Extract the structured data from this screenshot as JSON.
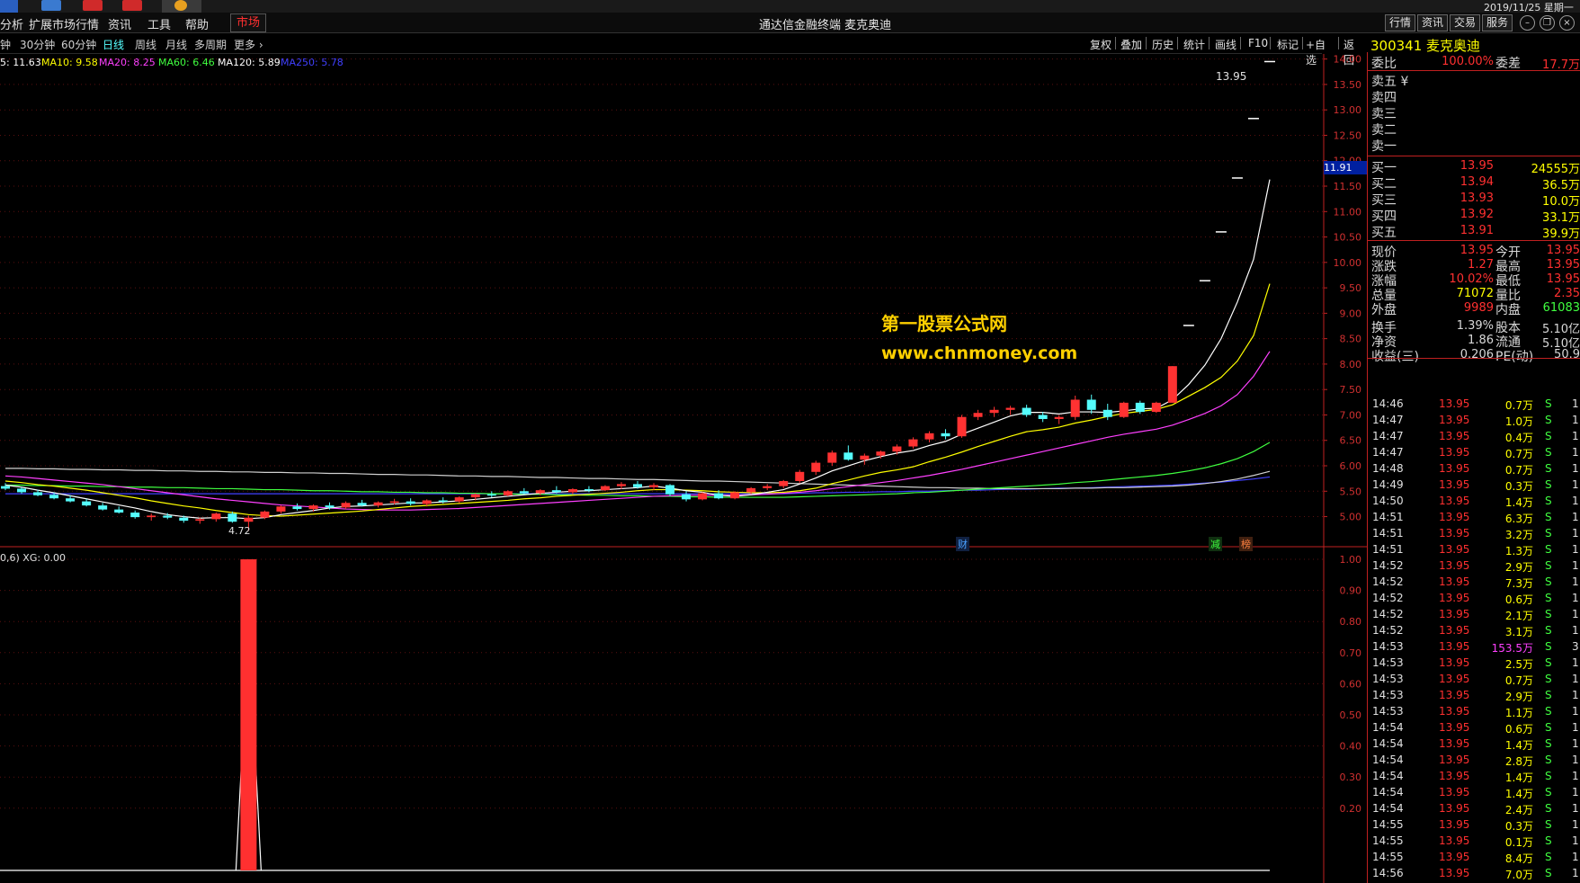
{
  "topbar": {
    "date_text": "2019/11/25 星期一"
  },
  "menu": {
    "items": [
      "分析",
      "扩展市场行情",
      "资讯",
      "工具",
      "帮助"
    ],
    "market_tab": "市场",
    "window_title": "通达信金融终端  麦克奥迪",
    "right_buttons": [
      "行情",
      "资讯",
      "交易",
      "服务"
    ]
  },
  "periods": {
    "items": [
      "钟",
      "30分钟",
      "60分钟",
      "日线",
      "周线",
      "月线",
      "多周期",
      "更多 ›"
    ],
    "active": "日线"
  },
  "tools": [
    "复权",
    "叠加",
    "历史",
    "统计",
    "画线",
    "F10",
    "标记",
    "+自选",
    "返回"
  ],
  "stock": {
    "code": "300341",
    "name": "麦克奥迪"
  },
  "ma_line": {
    "items": [
      {
        "text": "5: 11.63",
        "color": "#ffffff"
      },
      {
        "text": "MA10: 9.58",
        "color": "#ffff00"
      },
      {
        "text": "MA20: 8.25",
        "color": "#ff40ff"
      },
      {
        "text": "MA60: 6.46",
        "color": "#40ff40"
      },
      {
        "text": "MA120: 5.89",
        "color": "#ffffff"
      },
      {
        "text": "MA250: 5.78",
        "color": "#4040ff"
      }
    ]
  },
  "indicator_label": "0,6)  XG: 0.00",
  "chart_markers": {
    "high_label": "13.95",
    "low_label": "4.72",
    "cursor_price": "11.91",
    "event_tags": [
      {
        "text": "财",
        "color": "#4aa0ff"
      },
      {
        "text": "减",
        "color": "#40ff40"
      },
      {
        "text": "榜",
        "color": "#ff8040"
      }
    ]
  },
  "watermark": {
    "line1": "第一股票公式网",
    "line2": "www.chnmoney.com"
  },
  "colors": {
    "up": "#ff3232",
    "down": "#54fcfc",
    "axis": "#c02020",
    "text_red": "#ff3030",
    "text_yellow": "#ffff00",
    "text_green": "#40ff40"
  },
  "chart_data": {
    "type": "candlestick",
    "price_axis": {
      "ticks": [
        "14.00",
        "13.50",
        "13.00",
        "12.50",
        "12.00",
        "11.50",
        "11.00",
        "10.50",
        "10.00",
        "9.50",
        "9.00",
        "8.50",
        "8.00",
        "7.50",
        "7.00",
        "6.50",
        "6.00",
        "5.50",
        "5.00"
      ],
      "min": 4.55,
      "max": 14.1
    },
    "indicator_axis": {
      "ticks": [
        "1.00",
        "0.90",
        "0.80",
        "0.70",
        "0.60",
        "0.50",
        "0.40",
        "0.30",
        "0.20"
      ],
      "min": 0,
      "max": 1.0
    },
    "candles": [
      [
        5.6,
        5.66,
        5.52,
        5.55
      ],
      [
        5.55,
        5.58,
        5.45,
        5.48
      ],
      [
        5.48,
        5.53,
        5.4,
        5.42
      ],
      [
        5.43,
        5.48,
        5.34,
        5.36
      ],
      [
        5.36,
        5.42,
        5.28,
        5.3
      ],
      [
        5.3,
        5.35,
        5.2,
        5.22
      ],
      [
        5.22,
        5.27,
        5.12,
        5.14
      ],
      [
        5.14,
        5.2,
        5.06,
        5.08
      ],
      [
        5.08,
        5.12,
        4.96,
        4.99
      ],
      [
        4.99,
        5.06,
        4.92,
        5.02
      ],
      [
        5.02,
        5.07,
        4.95,
        4.98
      ],
      [
        4.98,
        5.02,
        4.88,
        4.92
      ],
      [
        4.92,
        4.98,
        4.86,
        4.95
      ],
      [
        4.95,
        5.08,
        4.9,
        5.06
      ],
      [
        5.06,
        5.1,
        4.88,
        4.9
      ],
      [
        4.9,
        5.02,
        4.72,
        4.98
      ],
      [
        4.98,
        5.12,
        4.95,
        5.1
      ],
      [
        5.1,
        5.22,
        5.06,
        5.2
      ],
      [
        5.2,
        5.26,
        5.12,
        5.15
      ],
      [
        5.15,
        5.24,
        5.1,
        5.22
      ],
      [
        5.22,
        5.28,
        5.14,
        5.18
      ],
      [
        5.18,
        5.3,
        5.15,
        5.27
      ],
      [
        5.27,
        5.33,
        5.2,
        5.22
      ],
      [
        5.22,
        5.3,
        5.18,
        5.28
      ],
      [
        5.28,
        5.35,
        5.24,
        5.3
      ],
      [
        5.3,
        5.36,
        5.22,
        5.25
      ],
      [
        5.25,
        5.34,
        5.2,
        5.32
      ],
      [
        5.32,
        5.38,
        5.26,
        5.3
      ],
      [
        5.3,
        5.4,
        5.27,
        5.38
      ],
      [
        5.38,
        5.46,
        5.32,
        5.44
      ],
      [
        5.44,
        5.5,
        5.38,
        5.42
      ],
      [
        5.42,
        5.52,
        5.4,
        5.5
      ],
      [
        5.5,
        5.56,
        5.44,
        5.46
      ],
      [
        5.46,
        5.54,
        5.42,
        5.52
      ],
      [
        5.52,
        5.6,
        5.46,
        5.48
      ],
      [
        5.48,
        5.56,
        5.44,
        5.54
      ],
      [
        5.54,
        5.6,
        5.48,
        5.52
      ],
      [
        5.52,
        5.62,
        5.5,
        5.6
      ],
      [
        5.6,
        5.68,
        5.54,
        5.64
      ],
      [
        5.64,
        5.7,
        5.55,
        5.58
      ],
      [
        5.58,
        5.66,
        5.52,
        5.62
      ],
      [
        5.62,
        5.64,
        5.4,
        5.44
      ],
      [
        5.44,
        5.5,
        5.3,
        5.34
      ],
      [
        5.34,
        5.48,
        5.32,
        5.46
      ],
      [
        5.46,
        5.52,
        5.34,
        5.36
      ],
      [
        5.36,
        5.5,
        5.34,
        5.48
      ],
      [
        5.48,
        5.58,
        5.44,
        5.56
      ],
      [
        5.56,
        5.64,
        5.52,
        5.6
      ],
      [
        5.6,
        5.72,
        5.56,
        5.7
      ],
      [
        5.7,
        5.92,
        5.66,
        5.88
      ],
      [
        5.88,
        6.1,
        5.82,
        6.06
      ],
      [
        6.06,
        6.3,
        6.0,
        6.26
      ],
      [
        6.26,
        6.4,
        6.1,
        6.12
      ],
      [
        6.12,
        6.24,
        6.02,
        6.2
      ],
      [
        6.2,
        6.3,
        6.14,
        6.28
      ],
      [
        6.28,
        6.42,
        6.22,
        6.38
      ],
      [
        6.38,
        6.56,
        6.34,
        6.52
      ],
      [
        6.52,
        6.68,
        6.46,
        6.64
      ],
      [
        6.64,
        6.72,
        6.52,
        6.58
      ],
      [
        6.58,
        7.0,
        6.55,
        6.96
      ],
      [
        6.96,
        7.1,
        6.9,
        7.04
      ],
      [
        7.04,
        7.16,
        6.96,
        7.1
      ],
      [
        7.1,
        7.18,
        7.0,
        7.14
      ],
      [
        7.14,
        7.2,
        6.96,
        7.0
      ],
      [
        7.0,
        7.06,
        6.86,
        6.92
      ],
      [
        6.92,
        7.0,
        6.82,
        6.96
      ],
      [
        6.96,
        7.38,
        6.9,
        7.3
      ],
      [
        7.3,
        7.4,
        7.02,
        7.1
      ],
      [
        7.1,
        7.22,
        6.9,
        6.96
      ],
      [
        6.96,
        7.26,
        6.94,
        7.24
      ],
      [
        7.24,
        7.28,
        7.02,
        7.06
      ],
      [
        7.06,
        7.26,
        7.04,
        7.24
      ],
      [
        7.24,
        7.96,
        7.24,
        7.96
      ],
      [
        8.76,
        8.76,
        8.76,
        8.76
      ],
      [
        9.64,
        9.64,
        9.64,
        9.64
      ],
      [
        10.6,
        10.6,
        10.6,
        10.6
      ],
      [
        11.66,
        11.66,
        11.66,
        11.66
      ],
      [
        12.83,
        12.83,
        12.83,
        12.83
      ],
      [
        13.95,
        13.95,
        13.95,
        13.95
      ]
    ],
    "ma5": [
      5.62,
      5.58,
      5.52,
      5.47,
      5.41,
      5.35,
      5.29,
      5.23,
      5.17,
      5.1,
      5.04,
      5.0,
      4.97,
      4.98,
      4.98,
      4.96,
      4.98,
      5.04,
      5.08,
      5.12,
      5.17,
      5.2,
      5.21,
      5.23,
      5.25,
      5.27,
      5.27,
      5.29,
      5.31,
      5.34,
      5.37,
      5.4,
      5.43,
      5.46,
      5.48,
      5.5,
      5.51,
      5.53,
      5.55,
      5.57,
      5.6,
      5.56,
      5.51,
      5.48,
      5.42,
      5.4,
      5.43,
      5.48,
      5.53,
      5.64,
      5.76,
      5.9,
      6.0,
      6.1,
      6.18,
      6.25,
      6.3,
      6.4,
      6.48,
      6.62,
      6.74,
      6.86,
      6.98,
      7.05,
      7.05,
      7.02,
      7.06,
      7.06,
      7.05,
      7.08,
      7.12,
      7.13,
      7.3,
      7.6,
      7.98,
      8.5,
      9.22,
      10.06,
      11.63
    ],
    "ma10": [
      5.7,
      5.67,
      5.63,
      5.6,
      5.56,
      5.52,
      5.47,
      5.42,
      5.37,
      5.31,
      5.26,
      5.21,
      5.17,
      5.12,
      5.08,
      5.04,
      5.02,
      5.01,
      5.03,
      5.05,
      5.07,
      5.09,
      5.11,
      5.14,
      5.17,
      5.2,
      5.22,
      5.24,
      5.26,
      5.28,
      5.3,
      5.32,
      5.35,
      5.37,
      5.4,
      5.42,
      5.44,
      5.46,
      5.48,
      5.51,
      5.53,
      5.53,
      5.52,
      5.51,
      5.49,
      5.48,
      5.47,
      5.47,
      5.48,
      5.51,
      5.56,
      5.65,
      5.72,
      5.8,
      5.87,
      5.92,
      5.98,
      6.08,
      6.17,
      6.27,
      6.38,
      6.48,
      6.58,
      6.67,
      6.71,
      6.76,
      6.84,
      6.9,
      6.97,
      7.03,
      7.07,
      7.11,
      7.2,
      7.37,
      7.54,
      7.74,
      8.06,
      8.56,
      9.58
    ],
    "ma20": [
      5.8,
      5.78,
      5.75,
      5.72,
      5.69,
      5.66,
      5.63,
      5.59,
      5.55,
      5.51,
      5.47,
      5.43,
      5.39,
      5.35,
      5.32,
      5.29,
      5.26,
      5.23,
      5.21,
      5.19,
      5.17,
      5.15,
      5.14,
      5.13,
      5.13,
      5.13,
      5.14,
      5.15,
      5.16,
      5.18,
      5.2,
      5.22,
      5.24,
      5.26,
      5.28,
      5.3,
      5.32,
      5.34,
      5.36,
      5.38,
      5.4,
      5.41,
      5.42,
      5.42,
      5.42,
      5.42,
      5.43,
      5.44,
      5.46,
      5.48,
      5.51,
      5.55,
      5.59,
      5.63,
      5.67,
      5.71,
      5.76,
      5.81,
      5.87,
      5.93,
      6.0,
      6.07,
      6.14,
      6.21,
      6.28,
      6.35,
      6.42,
      6.49,
      6.56,
      6.62,
      6.67,
      6.72,
      6.8,
      6.91,
      7.03,
      7.18,
      7.4,
      7.76,
      8.25
    ],
    "ma60": [
      5.62,
      5.62,
      5.61,
      5.61,
      5.6,
      5.6,
      5.59,
      5.59,
      5.58,
      5.58,
      5.57,
      5.57,
      5.56,
      5.55,
      5.55,
      5.54,
      5.53,
      5.53,
      5.52,
      5.51,
      5.51,
      5.5,
      5.49,
      5.49,
      5.48,
      5.48,
      5.47,
      5.47,
      5.46,
      5.46,
      5.45,
      5.45,
      5.44,
      5.44,
      5.43,
      5.43,
      5.42,
      5.42,
      5.41,
      5.41,
      5.4,
      5.4,
      5.39,
      5.39,
      5.38,
      5.38,
      5.38,
      5.38,
      5.38,
      5.39,
      5.4,
      5.41,
      5.42,
      5.43,
      5.44,
      5.45,
      5.47,
      5.48,
      5.5,
      5.52,
      5.54,
      5.56,
      5.58,
      5.6,
      5.62,
      5.64,
      5.67,
      5.69,
      5.72,
      5.75,
      5.78,
      5.81,
      5.85,
      5.9,
      5.96,
      6.04,
      6.14,
      6.28,
      6.46
    ],
    "ma120": [
      5.95,
      5.95,
      5.94,
      5.94,
      5.93,
      5.93,
      5.92,
      5.92,
      5.91,
      5.91,
      5.9,
      5.9,
      5.89,
      5.89,
      5.88,
      5.88,
      5.87,
      5.87,
      5.86,
      5.86,
      5.85,
      5.85,
      5.84,
      5.83,
      5.83,
      5.82,
      5.82,
      5.81,
      5.8,
      5.8,
      5.79,
      5.79,
      5.78,
      5.77,
      5.77,
      5.76,
      5.75,
      5.75,
      5.74,
      5.73,
      5.73,
      5.72,
      5.71,
      5.7,
      5.7,
      5.69,
      5.68,
      5.67,
      5.66,
      5.65,
      5.64,
      5.63,
      5.62,
      5.61,
      5.6,
      5.59,
      5.58,
      5.57,
      5.57,
      5.56,
      5.56,
      5.55,
      5.55,
      5.55,
      5.55,
      5.55,
      5.56,
      5.56,
      5.57,
      5.57,
      5.58,
      5.59,
      5.6,
      5.62,
      5.65,
      5.69,
      5.74,
      5.81,
      5.89
    ],
    "ma250": [
      5.45,
      5.45,
      5.45,
      5.45,
      5.45,
      5.45,
      5.45,
      5.45,
      5.45,
      5.45,
      5.45,
      5.45,
      5.45,
      5.45,
      5.45,
      5.45,
      5.45,
      5.45,
      5.45,
      5.45,
      5.45,
      5.45,
      5.45,
      5.45,
      5.45,
      5.45,
      5.45,
      5.45,
      5.45,
      5.45,
      5.45,
      5.45,
      5.45,
      5.45,
      5.45,
      5.45,
      5.45,
      5.45,
      5.45,
      5.45,
      5.45,
      5.45,
      5.45,
      5.45,
      5.45,
      5.45,
      5.45,
      5.45,
      5.45,
      5.46,
      5.47,
      5.47,
      5.48,
      5.48,
      5.49,
      5.49,
      5.5,
      5.5,
      5.51,
      5.52,
      5.52,
      5.53,
      5.54,
      5.54,
      5.55,
      5.56,
      5.56,
      5.57,
      5.58,
      5.59,
      5.6,
      5.61,
      5.62,
      5.64,
      5.66,
      5.68,
      5.71,
      5.74,
      5.78
    ],
    "xg_signal": [
      0,
      0,
      0,
      0,
      0,
      0,
      0,
      0,
      0,
      0,
      0,
      0,
      0,
      0,
      0,
      1,
      0,
      0,
      0,
      0,
      0,
      0,
      0,
      0,
      0,
      0,
      0,
      0,
      0,
      0,
      0,
      0,
      0,
      0,
      0,
      0,
      0,
      0,
      0,
      0,
      0,
      0,
      0,
      0,
      0,
      0,
      0,
      0,
      0,
      0,
      0,
      0,
      0,
      0,
      0,
      0,
      0,
      0,
      0,
      0,
      0,
      0,
      0,
      0,
      0,
      0,
      0,
      0,
      0,
      0,
      0,
      0,
      0,
      0,
      0,
      0,
      0,
      0,
      0
    ]
  },
  "quote": {
    "weibi_label": "委比",
    "weibi": "100.00%",
    "weicha_label": "委差",
    "weicha": "17.7万",
    "asks": [
      {
        "label": "卖五 ¥"
      },
      {
        "label": "卖四"
      },
      {
        "label": "卖三"
      },
      {
        "label": "卖二"
      },
      {
        "label": "卖一"
      }
    ],
    "bids": [
      {
        "label": "买一",
        "price": "13.95",
        "vol": "24555万"
      },
      {
        "label": "买二",
        "price": "13.94",
        "vol": "36.5万"
      },
      {
        "label": "买三",
        "price": "13.93",
        "vol": "10.0万"
      },
      {
        "label": "买四",
        "price": "13.92",
        "vol": "33.1万"
      },
      {
        "label": "买五",
        "price": "13.91",
        "vol": "39.9万"
      }
    ],
    "stats": [
      {
        "l1": "现价",
        "v1": "13.95",
        "c1": "#ff3030",
        "l2": "今开",
        "v2": "13.95",
        "c2": "#ff3030"
      },
      {
        "l1": "涨跌",
        "v1": "1.27",
        "c1": "#ff3030",
        "l2": "最高",
        "v2": "13.95",
        "c2": "#ff3030"
      },
      {
        "l1": "涨幅",
        "v1": "10.02%",
        "c1": "#ff3030",
        "l2": "最低",
        "v2": "13.95",
        "c2": "#ff3030"
      },
      {
        "l1": "总量",
        "v1": "71072",
        "c1": "#ffff00",
        "l2": "量比",
        "v2": "2.35",
        "c2": "#ff3030"
      },
      {
        "l1": "外盘",
        "v1": "9989",
        "c1": "#ff3030",
        "l2": "内盘",
        "v2": "61083",
        "c2": "#40ff40"
      },
      {
        "l1": "换手",
        "v1": "1.39%",
        "c1": "#d8d8d8",
        "l2": "股本",
        "v2": "5.10亿",
        "c2": "#d8d8d8"
      },
      {
        "l1": "净资",
        "v1": "1.86",
        "c1": "#d8d8d8",
        "l2": "流通",
        "v2": "5.10亿",
        "c2": "#d8d8d8"
      },
      {
        "l1": "收益(三)",
        "v1": "0.206",
        "c1": "#d8d8d8",
        "l2": "PE(动)",
        "v2": "50.9",
        "c2": "#d8d8d8"
      }
    ]
  },
  "ticks": [
    {
      "t": "14:46",
      "p": "13.95",
      "v": "0.7万",
      "s": "S",
      "n": "1"
    },
    {
      "t": "14:47",
      "p": "13.95",
      "v": "1.0万",
      "s": "S",
      "n": "1"
    },
    {
      "t": "14:47",
      "p": "13.95",
      "v": "0.4万",
      "s": "S",
      "n": "1"
    },
    {
      "t": "14:47",
      "p": "13.95",
      "v": "0.7万",
      "s": "S",
      "n": "1"
    },
    {
      "t": "14:48",
      "p": "13.95",
      "v": "0.7万",
      "s": "S",
      "n": "1"
    },
    {
      "t": "14:49",
      "p": "13.95",
      "v": "0.3万",
      "s": "S",
      "n": "1"
    },
    {
      "t": "14:50",
      "p": "13.95",
      "v": "1.4万",
      "s": "S",
      "n": "1"
    },
    {
      "t": "14:51",
      "p": "13.95",
      "v": "6.3万",
      "s": "S",
      "n": "1"
    },
    {
      "t": "14:51",
      "p": "13.95",
      "v": "3.2万",
      "s": "S",
      "n": "1"
    },
    {
      "t": "14:51",
      "p": "13.95",
      "v": "1.3万",
      "s": "S",
      "n": "1"
    },
    {
      "t": "14:52",
      "p": "13.95",
      "v": "2.9万",
      "s": "S",
      "n": "1"
    },
    {
      "t": "14:52",
      "p": "13.95",
      "v": "7.3万",
      "s": "S",
      "n": "1"
    },
    {
      "t": "14:52",
      "p": "13.95",
      "v": "0.6万",
      "s": "S",
      "n": "1"
    },
    {
      "t": "14:52",
      "p": "13.95",
      "v": "2.1万",
      "s": "S",
      "n": "1"
    },
    {
      "t": "14:52",
      "p": "13.95",
      "v": "3.1万",
      "s": "S",
      "n": "1"
    },
    {
      "t": "14:53",
      "p": "13.95",
      "v": "153.5万",
      "s": "S",
      "n": "3",
      "vc": "#ff40ff"
    },
    {
      "t": "14:53",
      "p": "13.95",
      "v": "2.5万",
      "s": "S",
      "n": "1"
    },
    {
      "t": "14:53",
      "p": "13.95",
      "v": "0.7万",
      "s": "S",
      "n": "1"
    },
    {
      "t": "14:53",
      "p": "13.95",
      "v": "2.9万",
      "s": "S",
      "n": "1"
    },
    {
      "t": "14:53",
      "p": "13.95",
      "v": "1.1万",
      "s": "S",
      "n": "1"
    },
    {
      "t": "14:54",
      "p": "13.95",
      "v": "0.6万",
      "s": "S",
      "n": "1"
    },
    {
      "t": "14:54",
      "p": "13.95",
      "v": "1.4万",
      "s": "S",
      "n": "1"
    },
    {
      "t": "14:54",
      "p": "13.95",
      "v": "2.8万",
      "s": "S",
      "n": "1"
    },
    {
      "t": "14:54",
      "p": "13.95",
      "v": "1.4万",
      "s": "S",
      "n": "1"
    },
    {
      "t": "14:54",
      "p": "13.95",
      "v": "1.4万",
      "s": "S",
      "n": "1"
    },
    {
      "t": "14:54",
      "p": "13.95",
      "v": "2.4万",
      "s": "S",
      "n": "1"
    },
    {
      "t": "14:55",
      "p": "13.95",
      "v": "0.3万",
      "s": "S",
      "n": "1"
    },
    {
      "t": "14:55",
      "p": "13.95",
      "v": "0.1万",
      "s": "S",
      "n": "1"
    },
    {
      "t": "14:55",
      "p": "13.95",
      "v": "8.4万",
      "s": "S",
      "n": "1"
    },
    {
      "t": "14:56",
      "p": "13.95",
      "v": "7.0万",
      "s": "S",
      "n": "1"
    }
  ]
}
